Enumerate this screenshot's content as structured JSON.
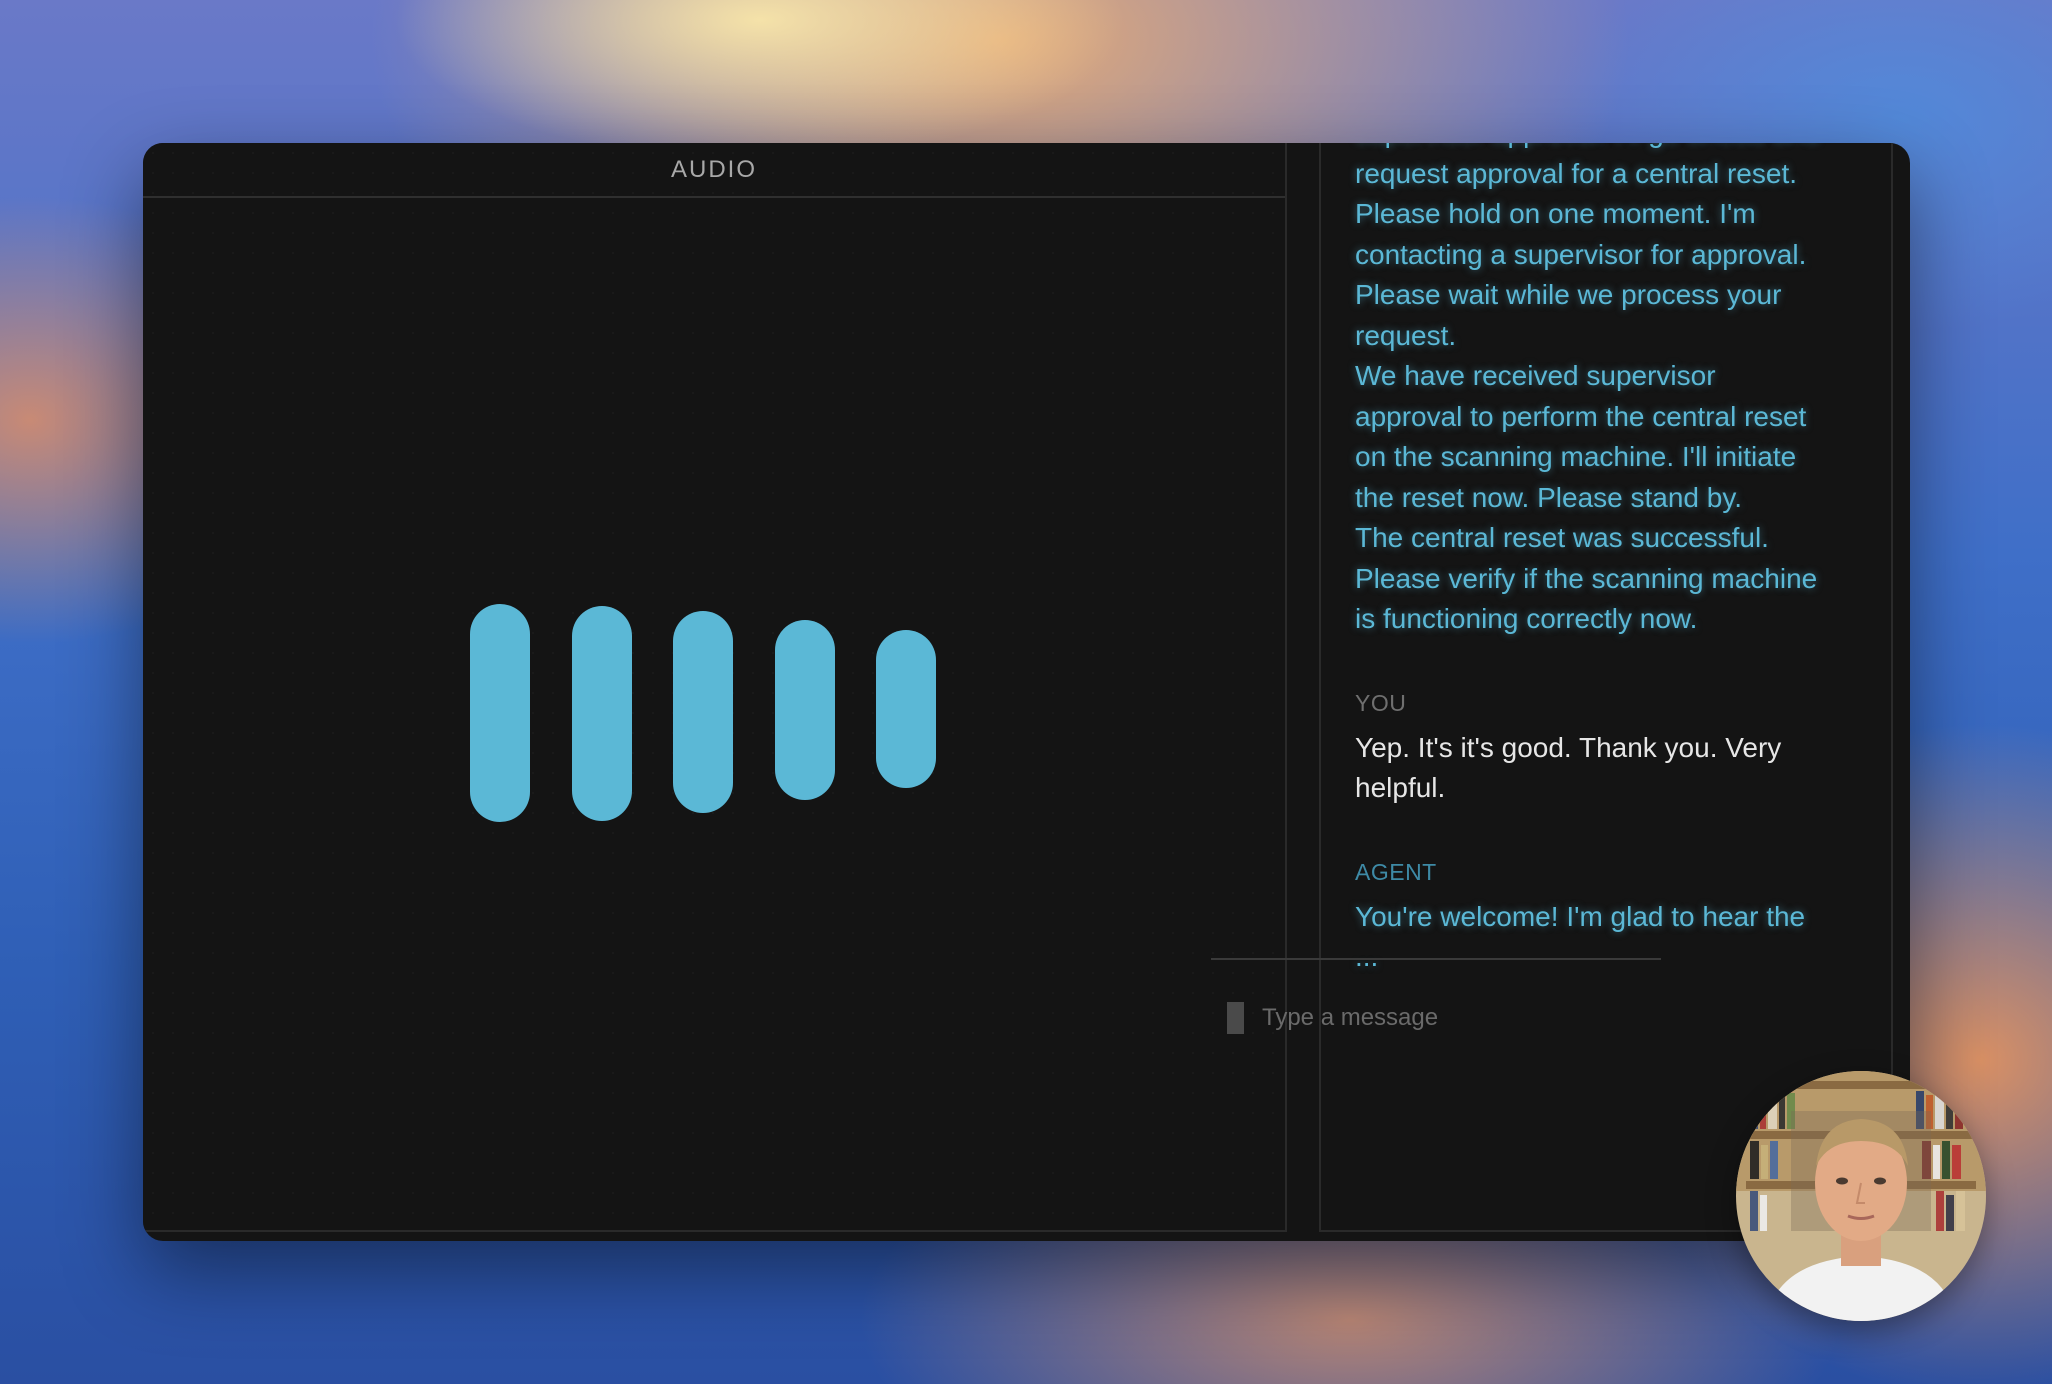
{
  "audio": {
    "title": "AUDIO",
    "level_bars": 5
  },
  "chat": {
    "agent_stream": [
      "supervisor approval. I'll go ahead and request approval for a central reset. Please hold on one moment. I'm contacting a supervisor for approval. Please wait while we process your request.",
      "We have received supervisor approval to perform the central reset on the scanning machine. I'll initiate the reset now. Please stand by.",
      "The central reset was successful. Please verify if the scanning machine is functioning correctly now."
    ],
    "you_label": "YOU",
    "you_message": "Yep. It's it's good. Thank you. Very helpful.",
    "agent_label": "AGENT",
    "agent_message": "You're welcome! I'm glad to hear the ...",
    "input_placeholder": "Type a message"
  },
  "colors": {
    "accent": "#5bb8d6",
    "window_bg": "#141414",
    "user_text": "#e6e6e6"
  }
}
